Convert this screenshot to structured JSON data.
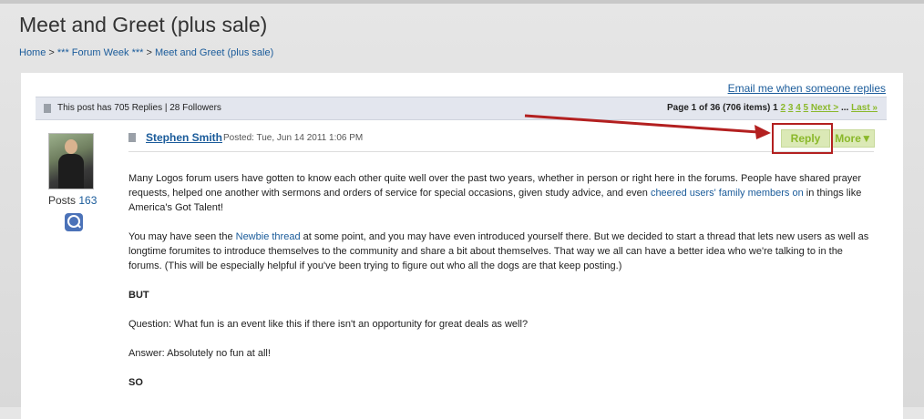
{
  "page": {
    "title": "Meet and Greet (plus sale)"
  },
  "breadcrumb": {
    "home": "Home",
    "sep1": " > ",
    "forum": "*** Forum Week ***",
    "sep2": " > ",
    "current": "Meet and Greet (plus sale)"
  },
  "actions": {
    "email_link": "Email me when someone replies"
  },
  "status": {
    "replies_text": "This post has 705 Replies | 28 Followers",
    "page_info": "Page 1 of 36 (706 items)",
    "current_page": "1",
    "pages": [
      "2",
      "3",
      "4",
      "5"
    ],
    "next": "Next >",
    "ellipsis": "...",
    "last": "Last »"
  },
  "author": {
    "name": "Stephen Smith",
    "posted": "Posted: Tue, Jun 14 2011 1:06 PM",
    "posts_label": "Posts",
    "posts_count": "163"
  },
  "post_buttons": {
    "reply": "Reply",
    "more": "More▼"
  },
  "post": {
    "p1_a": "Many Logos forum users have gotten to know each other quite well over the past two years, whether in person or right here in the forums. People have shared prayer requests, helped one another with sermons and orders of service for special occasions, given study advice, and even ",
    "p1_link": "cheered users' family members on",
    "p1_b": " in things like America's Got Talent!",
    "p2_a": "You may have seen the ",
    "p2_link": "Newbie thread",
    "p2_b": " at some point, and you may have even introduced yourself there. But we decided to start a thread that lets new users as well as longtime forumites to introduce themselves to the community and share a bit about themselves. That way we all can have a better idea who we're talking to in the forums. (This will be especially helpful if you've been trying to figure out who all the dogs are that keep posting.)",
    "p3": "BUT",
    "p4": "Question: What fun is an event like this if there isn't an opportunity for great deals as well?",
    "p5": "Answer: Absolutely no fun at all!",
    "p6": "SO"
  },
  "colors": {
    "link": "#1a5b9a",
    "accent_green": "#8ab82a",
    "highlight_red": "#b32020"
  }
}
